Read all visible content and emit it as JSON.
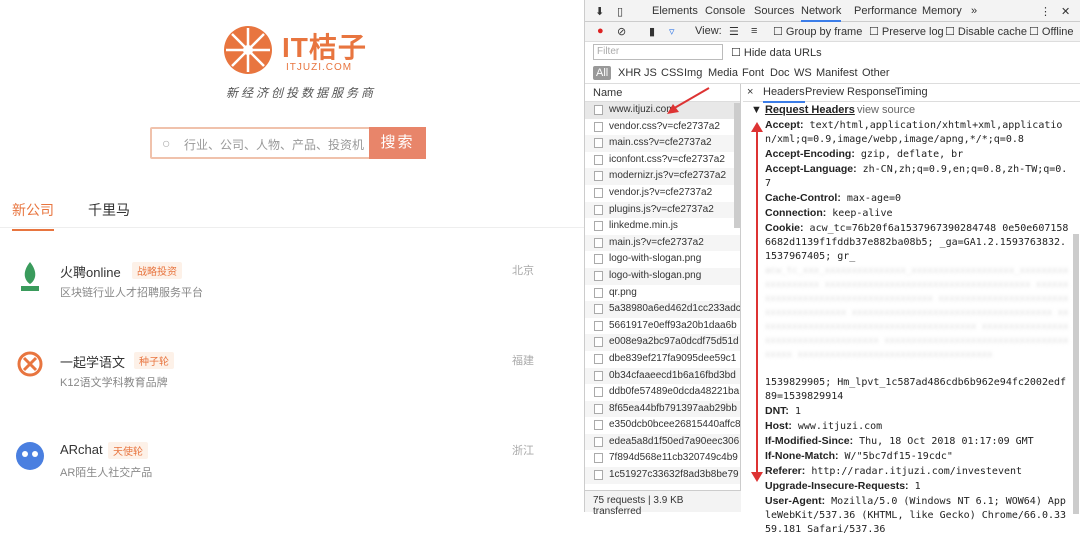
{
  "site": {
    "logo_text": "IT桔子",
    "logo_sub": "ITJUZI.COM",
    "slogan": "新经济创投数据服务商",
    "search_placeholder": "行业、公司、人物、产品、投资机构",
    "search_button": "搜索",
    "tabs": [
      "新公司",
      "千里马"
    ],
    "companies": [
      {
        "name": "火聘online",
        "badge": "战略投资",
        "desc": "区块链行业人才招聘服务平台",
        "city": "北京"
      },
      {
        "name": "一起学语文",
        "badge": "种子轮",
        "desc": "K12语文学科教育品牌",
        "city": "福建"
      },
      {
        "name": "ARchat",
        "badge": "天使轮",
        "desc": "AR陌生人社交产品",
        "city": "浙江"
      }
    ]
  },
  "devtools": {
    "tabs": [
      "Elements",
      "Console",
      "Sources",
      "Network",
      "Performance",
      "Memory",
      "»"
    ],
    "toolbar2": {
      "view": "View:",
      "group_by_frame": "Group by frame",
      "preserve_log": "Preserve log",
      "disable_cache": "Disable cache",
      "offline": "Offline"
    },
    "filter_placeholder": "Filter",
    "hide_data_urls": "Hide data URLs",
    "types": [
      "All",
      "XHR",
      "JS",
      "CSS",
      "Img",
      "Media",
      "Font",
      "Doc",
      "WS",
      "Manifest",
      "Other"
    ],
    "list_header": "Name",
    "requests": [
      "www.itjuzi.com",
      "vendor.css?v=cfe2737a2",
      "main.css?v=cfe2737a2",
      "iconfont.css?v=cfe2737a2",
      "modernizr.js?v=cfe2737a2",
      "vendor.js?v=cfe2737a2",
      "plugins.js?v=cfe2737a2",
      "linkedme.min.js",
      "main.js?v=cfe2737a2",
      "logo-with-slogan.png",
      "logo-with-slogan.png",
      "qr.png",
      "5a38980a6ed462d1cc233adc",
      "5661917e0eff93a20b1daa6b",
      "e008e9a2bc97a0dcdf75d51d",
      "dbe839ef217fa9095dee59c1",
      "0b34cfaaeecd1b6a16fbd3bd",
      "ddb0fe57489e0dcda48221ba",
      "8f65ea44bfb791397aab29bb",
      "e350dcb0bcee26815440affc8",
      "edea5a8d1f50ed7a90eec306",
      "7f894d568e11cb320749c4b9",
      "1c51927c33632f8ad3b8be79"
    ],
    "footer": "75 requests | 3.9 KB transferred",
    "detail_tabs": [
      "×",
      "Headers",
      "Preview",
      "Response",
      "Timing"
    ],
    "request_headers_title": "Request Headers",
    "view_source": "view source",
    "headers": [
      {
        "k": "Accept:",
        "v": "text/html,application/xhtml+xml,application/xml;q=0.9,image/webp,image/apng,*/*;q=0.8"
      },
      {
        "k": "Accept-Encoding:",
        "v": "gzip, deflate, br"
      },
      {
        "k": "Accept-Language:",
        "v": "zh-CN,zh;q=0.9,en;q=0.8,zh-TW;q=0.7"
      },
      {
        "k": "Cache-Control:",
        "v": "max-age=0"
      },
      {
        "k": "Connection:",
        "v": "keep-alive"
      },
      {
        "k": "Cookie:",
        "v": "acw_tc=76b20f6a1537967390284748 0e50e6071586682d1139f1fddb37e882ba08b5; _ga=GA1.2.1593763832.1537967405; gr_"
      }
    ],
    "cookie_tail": "1539829905; Hm_lpvt_1c587ad486cdb6b962e94fc2002edf89=1539829914",
    "headers2": [
      {
        "k": "DNT:",
        "v": "1"
      },
      {
        "k": "Host:",
        "v": "www.itjuzi.com"
      },
      {
        "k": "If-Modified-Since:",
        "v": "Thu, 18 Oct 2018 01:17:09 GMT"
      },
      {
        "k": "If-None-Match:",
        "v": "W/\"5bc7df15-19cdc\""
      },
      {
        "k": "Referer:",
        "v": "http://radar.itjuzi.com/investevent"
      },
      {
        "k": "Upgrade-Insecure-Requests:",
        "v": "1"
      },
      {
        "k": "User-Agent:",
        "v": "Mozilla/5.0 (Windows NT 6.1; WOW64) AppleWebKit/537.36 (KHTML, like Gecko) Chrome/66.0.3359.181 Safari/537.36"
      }
    ]
  },
  "colors": {
    "brand": "#e8753f",
    "annotation": "#d33"
  }
}
